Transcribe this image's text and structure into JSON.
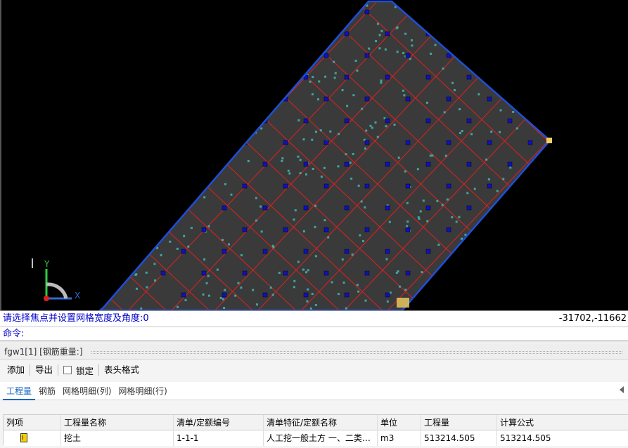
{
  "canvas": {
    "colors": {
      "background": "#000000",
      "region_fill": "#3a3a3a",
      "boundary": "#1e4fd8",
      "grid_lines": "#e02020",
      "nodes": "#1010c0",
      "points": "#3fa6a0"
    },
    "axis": {
      "y_label": "Y",
      "x_label": "X"
    }
  },
  "cmdline": {
    "prompt": "请选择焦点并设置网格宽度及角度:0",
    "coords": "-31702,-11662",
    "command": "命令:"
  },
  "panel": {
    "title": "fgw1[1] [钢筋重量:]",
    "toolbar": {
      "add": "添加",
      "export": "导出",
      "lock": "锁定",
      "header_format": "表头格式"
    },
    "tabs": [
      "工程量",
      "钢筋",
      "网格明细(列)",
      "网格明细(行)"
    ],
    "active_tab": 0,
    "table": {
      "headers": [
        "列项",
        "工程量名称",
        "清单/定额编号",
        "清单特征/定额名称",
        "单位",
        "工程量",
        "计算公式"
      ],
      "rows": [
        {
          "item_icon": "document-icon",
          "name": "挖土",
          "code": "1-1-1",
          "feature": "人工挖一般土方 一、二类土...",
          "unit": "m3",
          "quantity": "513214.505",
          "formula": "513214.505"
        }
      ]
    }
  }
}
